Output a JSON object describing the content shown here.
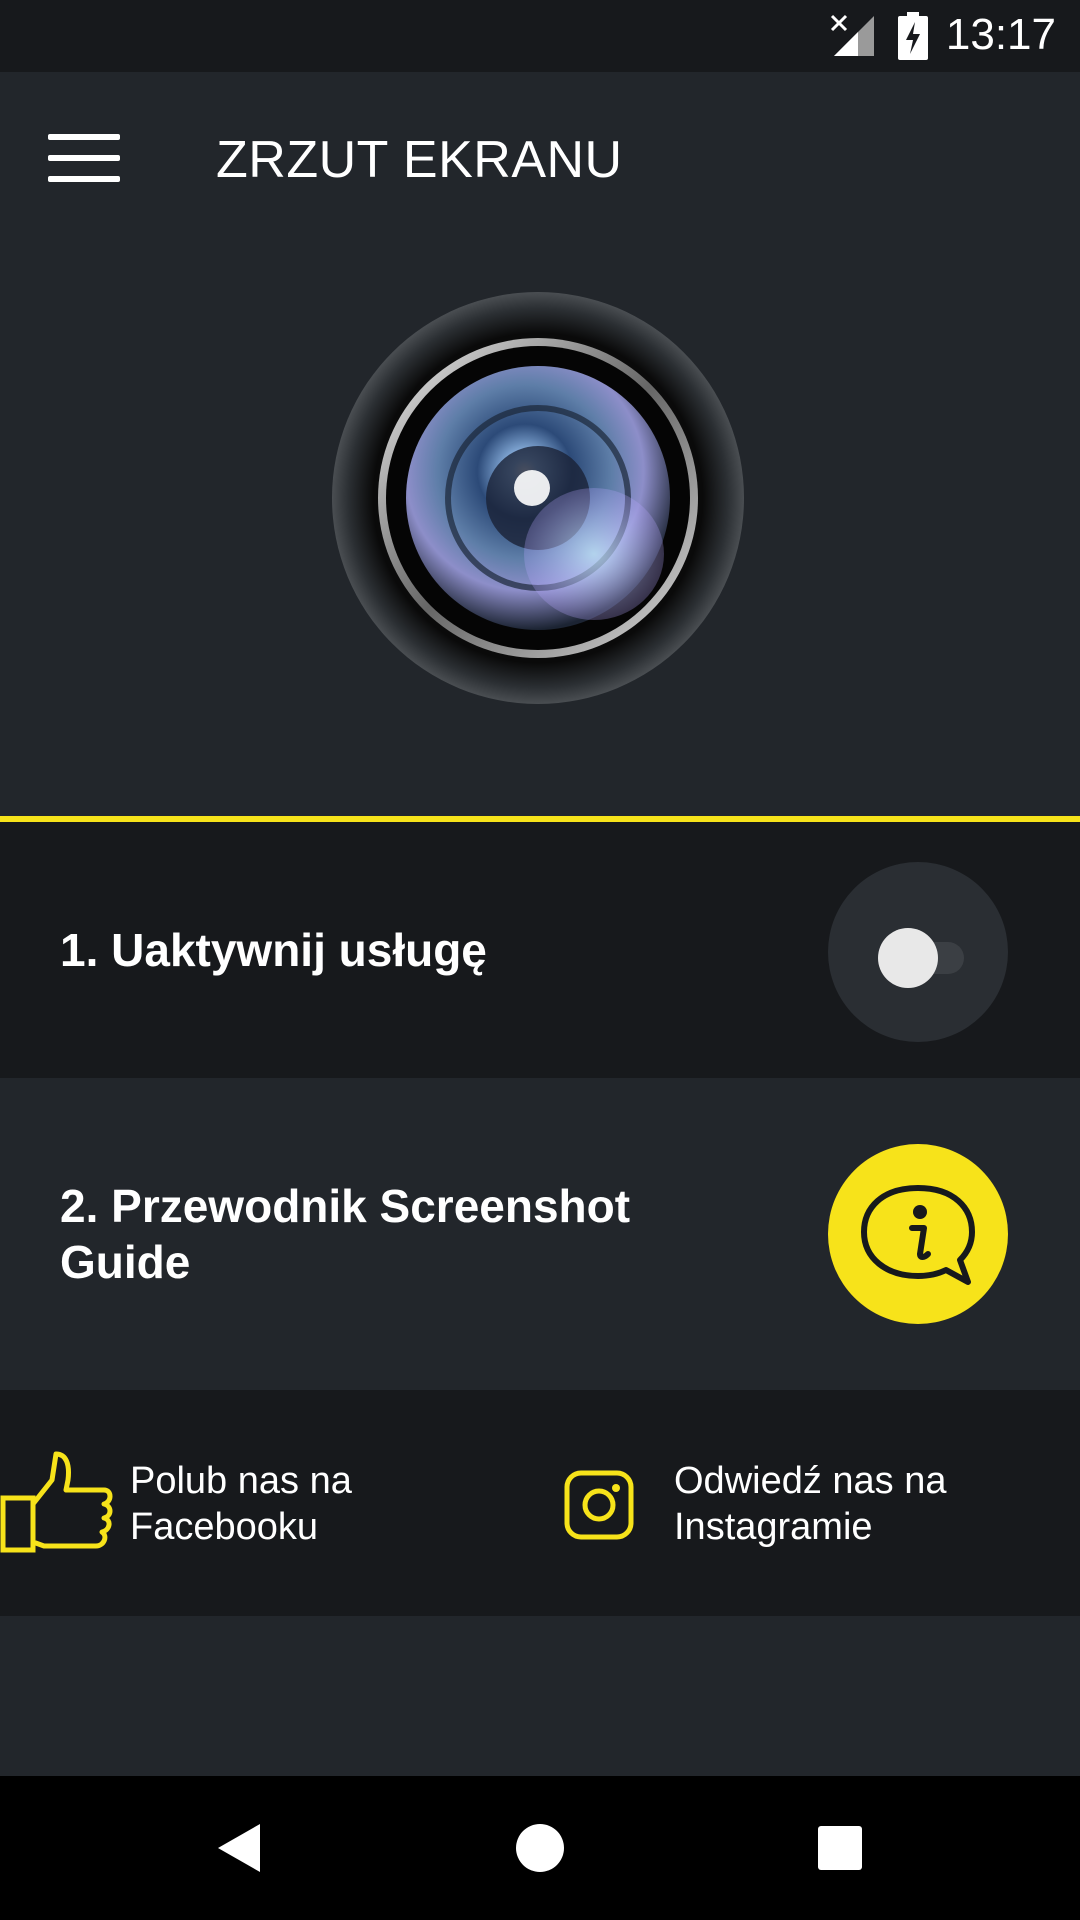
{
  "status_bar": {
    "time": "13:17",
    "signal_icon": "signal-off-icon",
    "battery_icon": "battery-charging-icon"
  },
  "app_bar": {
    "title": "ZRZUT EKRANU",
    "menu_icon": "hamburger-menu-icon"
  },
  "hero": {
    "image": "camera-lens-image"
  },
  "steps": [
    {
      "label": "1. Uaktywnij usługę",
      "control": "toggle",
      "state": "off"
    },
    {
      "label_line1": "2. Przewodnik Screenshot",
      "label_line2": "Guide",
      "control": "info-icon"
    }
  ],
  "social": {
    "facebook_line1": "Polub nas na",
    "facebook_line2": "Facebooku",
    "instagram_line1": "Odwiedź nas na",
    "instagram_line2": "Instagramie"
  },
  "colors": {
    "accent": "#f7e31a",
    "background": "#22262b",
    "dark_panel": "#17191c"
  },
  "nav": {
    "back": "back-triangle-icon",
    "home": "home-circle-icon",
    "recents": "recents-square-icon"
  }
}
